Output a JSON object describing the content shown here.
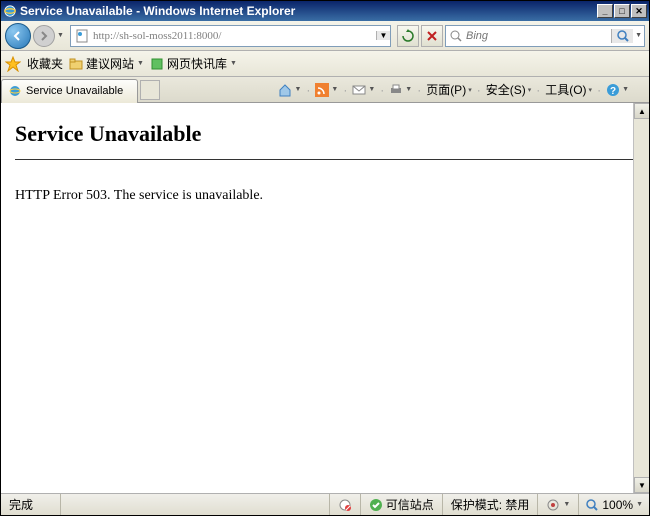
{
  "titlebar": {
    "title": "Service Unavailable - Windows Internet Explorer"
  },
  "nav": {
    "url": "http://sh-sol-moss2011:8000/",
    "search_placeholder": "Bing"
  },
  "favbar": {
    "label": "收藏夹",
    "item1": "建议网站",
    "item2": "网页快讯库"
  },
  "tab": {
    "label": "Service Unavailable"
  },
  "commands": {
    "page": "页面(P)",
    "safety": "安全(S)",
    "tools": "工具(O)"
  },
  "page": {
    "heading": "Service Unavailable",
    "message": "HTTP Error 503. The service is unavailable."
  },
  "status": {
    "done": "完成",
    "trusted": "可信站点",
    "protected": "保护模式: 禁用",
    "zoom": "100%"
  }
}
